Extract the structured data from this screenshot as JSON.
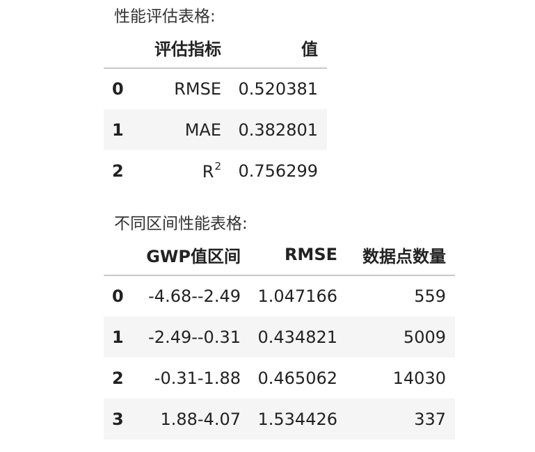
{
  "performance": {
    "caption": "性能评估表格:",
    "columns": [
      "",
      "评估指标",
      "值"
    ],
    "rows": [
      {
        "index": "0",
        "metric": "RMSE",
        "value": "0.520381"
      },
      {
        "index": "1",
        "metric": "MAE",
        "value": "0.382801"
      },
      {
        "index": "2",
        "metric": "R",
        "metric_sup": "2",
        "value": "0.756299"
      }
    ]
  },
  "interval": {
    "caption": "不同区间性能表格:",
    "columns": [
      "",
      "GWP值区间",
      "RMSE",
      "数据点数量"
    ],
    "rows": [
      {
        "index": "0",
        "range": "-4.68--2.49",
        "rmse": "1.047166",
        "count": "559"
      },
      {
        "index": "1",
        "range": "-2.49--0.31",
        "rmse": "0.434821",
        "count": "5009"
      },
      {
        "index": "2",
        "range": "-0.31-1.88",
        "rmse": "0.465062",
        "count": "14030"
      },
      {
        "index": "3",
        "range": "1.88-4.07",
        "rmse": "1.534426",
        "count": "337"
      }
    ]
  },
  "colors": {
    "stripe": "#f5f5f5",
    "header_rule": "#c8c8c8",
    "text": "#222222"
  }
}
